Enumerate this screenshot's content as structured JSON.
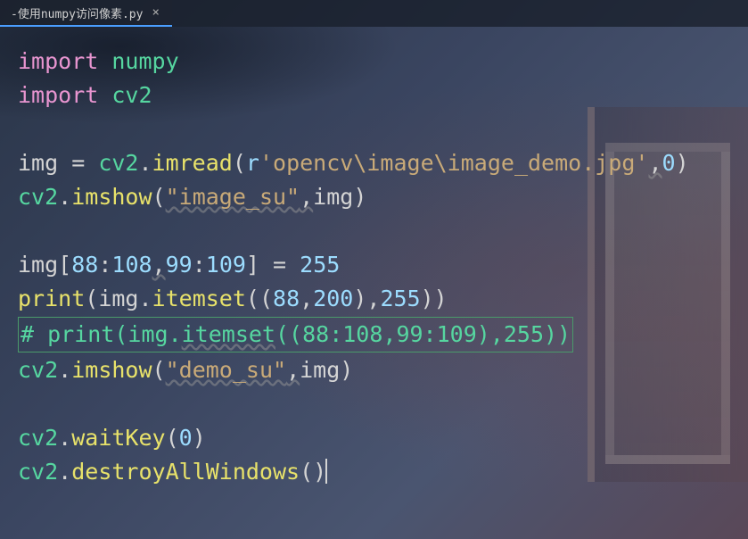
{
  "tab": {
    "filename": "-使用numpy访问像素.py",
    "close_label": "×"
  },
  "code": {
    "l1_import": "import",
    "l1_mod": "numpy",
    "l2_import": "import",
    "l2_mod": "cv2",
    "l4_var": "img",
    "l4_eq": " = ",
    "l4_cv2": "cv2",
    "l4_dot1": ".",
    "l4_imread": "imread",
    "l4_open": "(",
    "l4_r": "r",
    "l4_str": "'opencv\\image\\image_demo.jpg'",
    "l4_comma": ",",
    "l4_zero": "0",
    "l4_close": ")",
    "l5_cv2": "cv2",
    "l5_dot": ".",
    "l5_imshow": "imshow",
    "l5_open": "(",
    "l5_str": "\"image_su\"",
    "l5_comma": ",",
    "l5_img": "img",
    "l5_close": ")",
    "l7_img": "img",
    "l7_bracket_open": "[",
    "l7_n1": "88",
    "l7_colon1": ":",
    "l7_n2": "108",
    "l7_comma": ",",
    "l7_n3": "99",
    "l7_colon2": ":",
    "l7_n4": "109",
    "l7_bracket_close": "]",
    "l7_eq": " = ",
    "l7_val": "255",
    "l8_print": "print",
    "l8_open": "(",
    "l8_img": "img",
    "l8_dot": ".",
    "l8_itemset": "itemset",
    "l8_open2": "((",
    "l8_n1": "88",
    "l8_comma1": ",",
    "l8_n2": "200",
    "l8_close1": "),",
    "l8_n3": "255",
    "l8_close2": "))",
    "l9_comment": "# print(img.",
    "l9_itemset": "itemset",
    "l9_rest": "((88:108,99:109),255))",
    "l10_cv2": "cv2",
    "l10_dot": ".",
    "l10_imshow": "imshow",
    "l10_open": "(",
    "l10_str": "\"demo_su\"",
    "l10_comma": ",",
    "l10_img": "img",
    "l10_close": ")",
    "l12_cv2": "cv2",
    "l12_dot": ".",
    "l12_waitkey": "waitKey",
    "l12_open": "(",
    "l12_zero": "0",
    "l12_close": ")",
    "l13_cv2": "cv2",
    "l13_dot": ".",
    "l13_destroy": "destroyAllWindows",
    "l13_parens": "()"
  }
}
